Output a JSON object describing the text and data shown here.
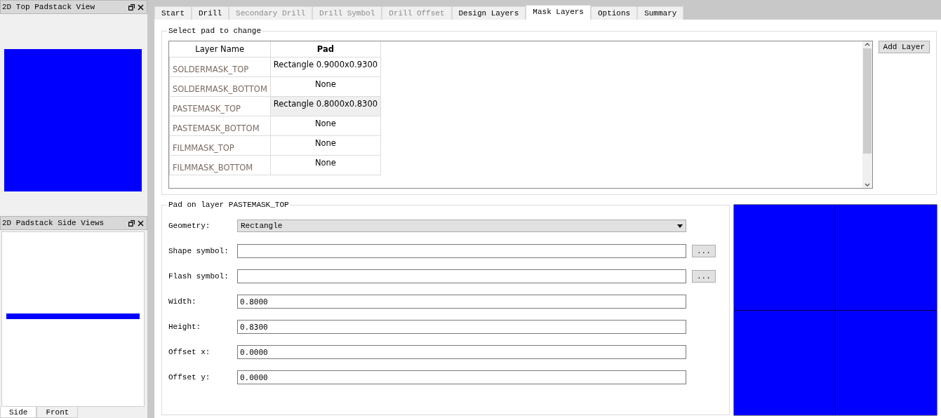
{
  "docks": [
    {
      "title": "2D Top Padstack View",
      "kind": "top"
    },
    {
      "title": "2D Padstack Side Views",
      "kind": "side",
      "tabs": [
        {
          "label": "Side",
          "selected": true
        },
        {
          "label": "Front",
          "selected": false
        }
      ]
    }
  ],
  "tabs": [
    {
      "label": "Start",
      "selected": false,
      "disabled": false
    },
    {
      "label": "Drill",
      "selected": false,
      "disabled": false
    },
    {
      "label": "Secondary Drill",
      "selected": false,
      "disabled": true
    },
    {
      "label": "Drill Symbol",
      "selected": false,
      "disabled": true
    },
    {
      "label": "Drill Offset",
      "selected": false,
      "disabled": true
    },
    {
      "label": "Design Layers",
      "selected": false,
      "disabled": false
    },
    {
      "label": "Mask Layers",
      "selected": true,
      "disabled": false
    },
    {
      "label": "Options",
      "selected": false,
      "disabled": false
    },
    {
      "label": "Summary",
      "selected": false,
      "disabled": false
    }
  ],
  "pad_group": {
    "title": "Select pad to change",
    "columns": [
      "Layer Name",
      "Pad"
    ],
    "rows": [
      {
        "layer": "SOLDERMASK_TOP",
        "pad": "Rectangle 0.9000x0.9300",
        "selected": false
      },
      {
        "layer": "SOLDERMASK_BOTTOM",
        "pad": "None",
        "selected": false
      },
      {
        "layer": "PASTEMASK_TOP",
        "pad": "Rectangle 0.8000x0.8300",
        "selected": true
      },
      {
        "layer": "PASTEMASK_BOTTOM",
        "pad": "None",
        "selected": false
      },
      {
        "layer": "FILMMASK_TOP",
        "pad": "None",
        "selected": false
      },
      {
        "layer": "FILMMASK_BOTTOM",
        "pad": "None",
        "selected": false
      }
    ],
    "button": "Add Layer"
  },
  "layer_group": {
    "title": "Pad on layer PASTEMASK_TOP",
    "fields": [
      {
        "label": "Geometry:",
        "kind": "select",
        "value": "Rectangle"
      },
      {
        "label": "Shape symbol:",
        "kind": "symbol",
        "button": "..."
      },
      {
        "label": "Flash symbol:",
        "kind": "symbol",
        "button": "..."
      },
      {
        "label": "Width:",
        "kind": "text",
        "value": "0.8000"
      },
      {
        "label": "Height:",
        "kind": "text",
        "value": "0.8300"
      },
      {
        "label": "Offset x:",
        "kind": "text",
        "value": "0.0000"
      },
      {
        "label": "Offset y:",
        "kind": "text",
        "value": "0.0000"
      }
    ]
  }
}
